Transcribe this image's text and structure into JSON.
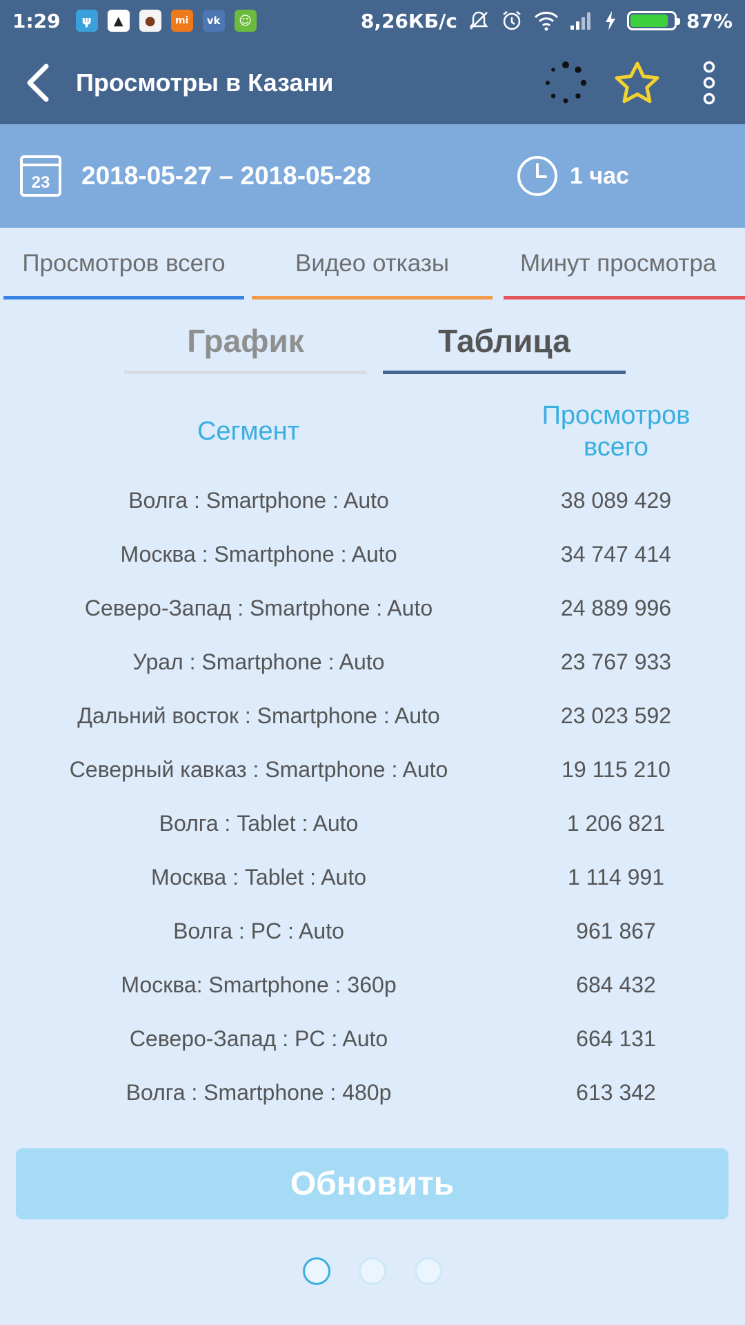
{
  "status_bar": {
    "time": "1:29",
    "net_speed": "8,26КБ/с",
    "battery_percent": "87%",
    "battery_level": 0.87,
    "notification_icons": [
      "usb-icon",
      "arrow-app-icon",
      "guard-app-icon",
      "mi-app-icon",
      "vk-icon",
      "android-app-icon"
    ]
  },
  "app_bar": {
    "title": "Просмотры в Казани",
    "icons": [
      "back-arrow-icon",
      "loading-spinner-icon",
      "star-icon",
      "more-vert-icon"
    ]
  },
  "date_band": {
    "calendar_day": "23",
    "date_range": "2018-05-27 – 2018-05-28",
    "period": "1 час"
  },
  "metric_tabs": [
    {
      "label": "Просмотров всего",
      "color": "#3b82e6"
    },
    {
      "label": "Видео отказы",
      "color": "#f29b48"
    },
    {
      "label": "Минут просмотра",
      "color": "#e5565a"
    }
  ],
  "view_tabs": {
    "chart": "График",
    "table": "Таблица",
    "selected": "table"
  },
  "table": {
    "headers": {
      "segment": "Сегмент",
      "views_line1": "Просмотров",
      "views_line2": "всего"
    },
    "rows": [
      {
        "segment": "Волга : Smartphone : Auto",
        "value": "38 089 429"
      },
      {
        "segment": "Москва : Smartphone : Auto",
        "value": "34 747 414"
      },
      {
        "segment": "Северо-Запад : Smartphone : Auto",
        "value": "24 889 996"
      },
      {
        "segment": "Урал : Smartphone : Auto",
        "value": "23 767 933"
      },
      {
        "segment": "Дальний восток : Smartphone : Auto",
        "value": "23 023 592"
      },
      {
        "segment": "Северный кавказ : Smartphone : Auto",
        "value": "19 115 210"
      },
      {
        "segment": "Волга : Tablet : Auto",
        "value": "1 206 821"
      },
      {
        "segment": "Москва : Tablet : Auto",
        "value": "1 114 991"
      },
      {
        "segment": "Волга : PC : Auto",
        "value": "961 867"
      },
      {
        "segment": "Москва: Smartphone : 360p",
        "value": "684 432"
      },
      {
        "segment": "Северо-Запад : PC : Auto",
        "value": "664 131"
      },
      {
        "segment": "Волга : Smartphone : 480p",
        "value": "613 342"
      }
    ]
  },
  "update_button": {
    "label": "Обновить"
  },
  "pagination": {
    "pages": 3,
    "current": 1
  },
  "colors": {
    "header": "#44658e",
    "date_band": "#7faadc",
    "background": "#ddebfb",
    "accent": "#3aaedf",
    "star": "#f2d22e"
  }
}
